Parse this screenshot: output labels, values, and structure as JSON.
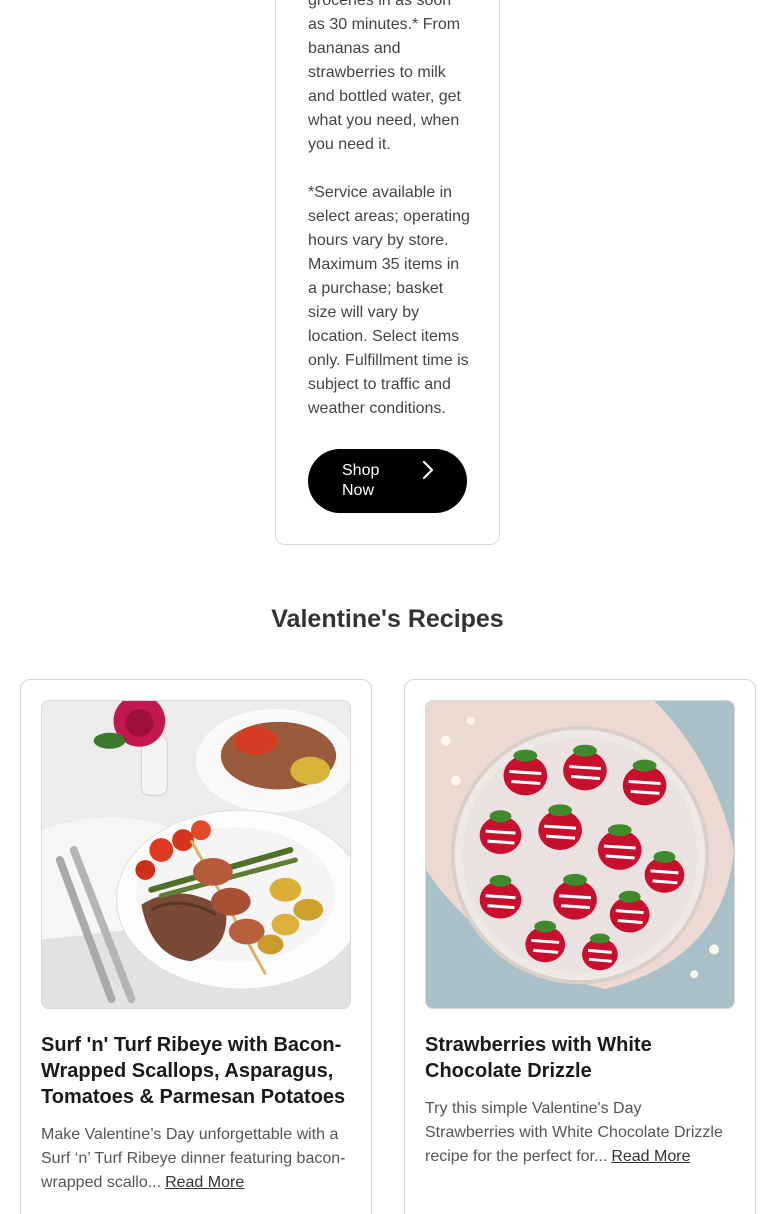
{
  "promo": {
    "paragraph1": "groceries in as soon as 30 minutes.* From bananas and strawberries to milk and bottled water, get what you need, when you need it.",
    "paragraph2": "*Service available in select areas; operating hours vary by store. Maximum 35 items in a purchase; basket size will vary by location. Select items only. Fulfillment time is subject to traffic and weather conditions.",
    "button_label": "Shop Now",
    "button_icon": "chevron-right-icon"
  },
  "section": {
    "title": "Valentine's Recipes"
  },
  "recipes": [
    {
      "title": "Surf 'n' Turf Ribeye with Bacon-Wrapped Scallops, Asparagus, Tomatoes & Parmesan Potatoes",
      "description": "Make Valentine’s Day unforgettable with a Surf ‘n’ Turf Ribeye dinner featuring bacon-wrapped scallo...",
      "read_more": "Read More"
    },
    {
      "title": "Strawberries with White Chocolate Drizzle",
      "description": "Try this simple Valentine's Day Strawberries with White Chocolate Drizzle recipe for the perfect for...",
      "read_more": "Read More"
    }
  ],
  "colors": {
    "button_bg": "#000000",
    "card_border": "#d9d9d9",
    "body_text": "#555555"
  }
}
